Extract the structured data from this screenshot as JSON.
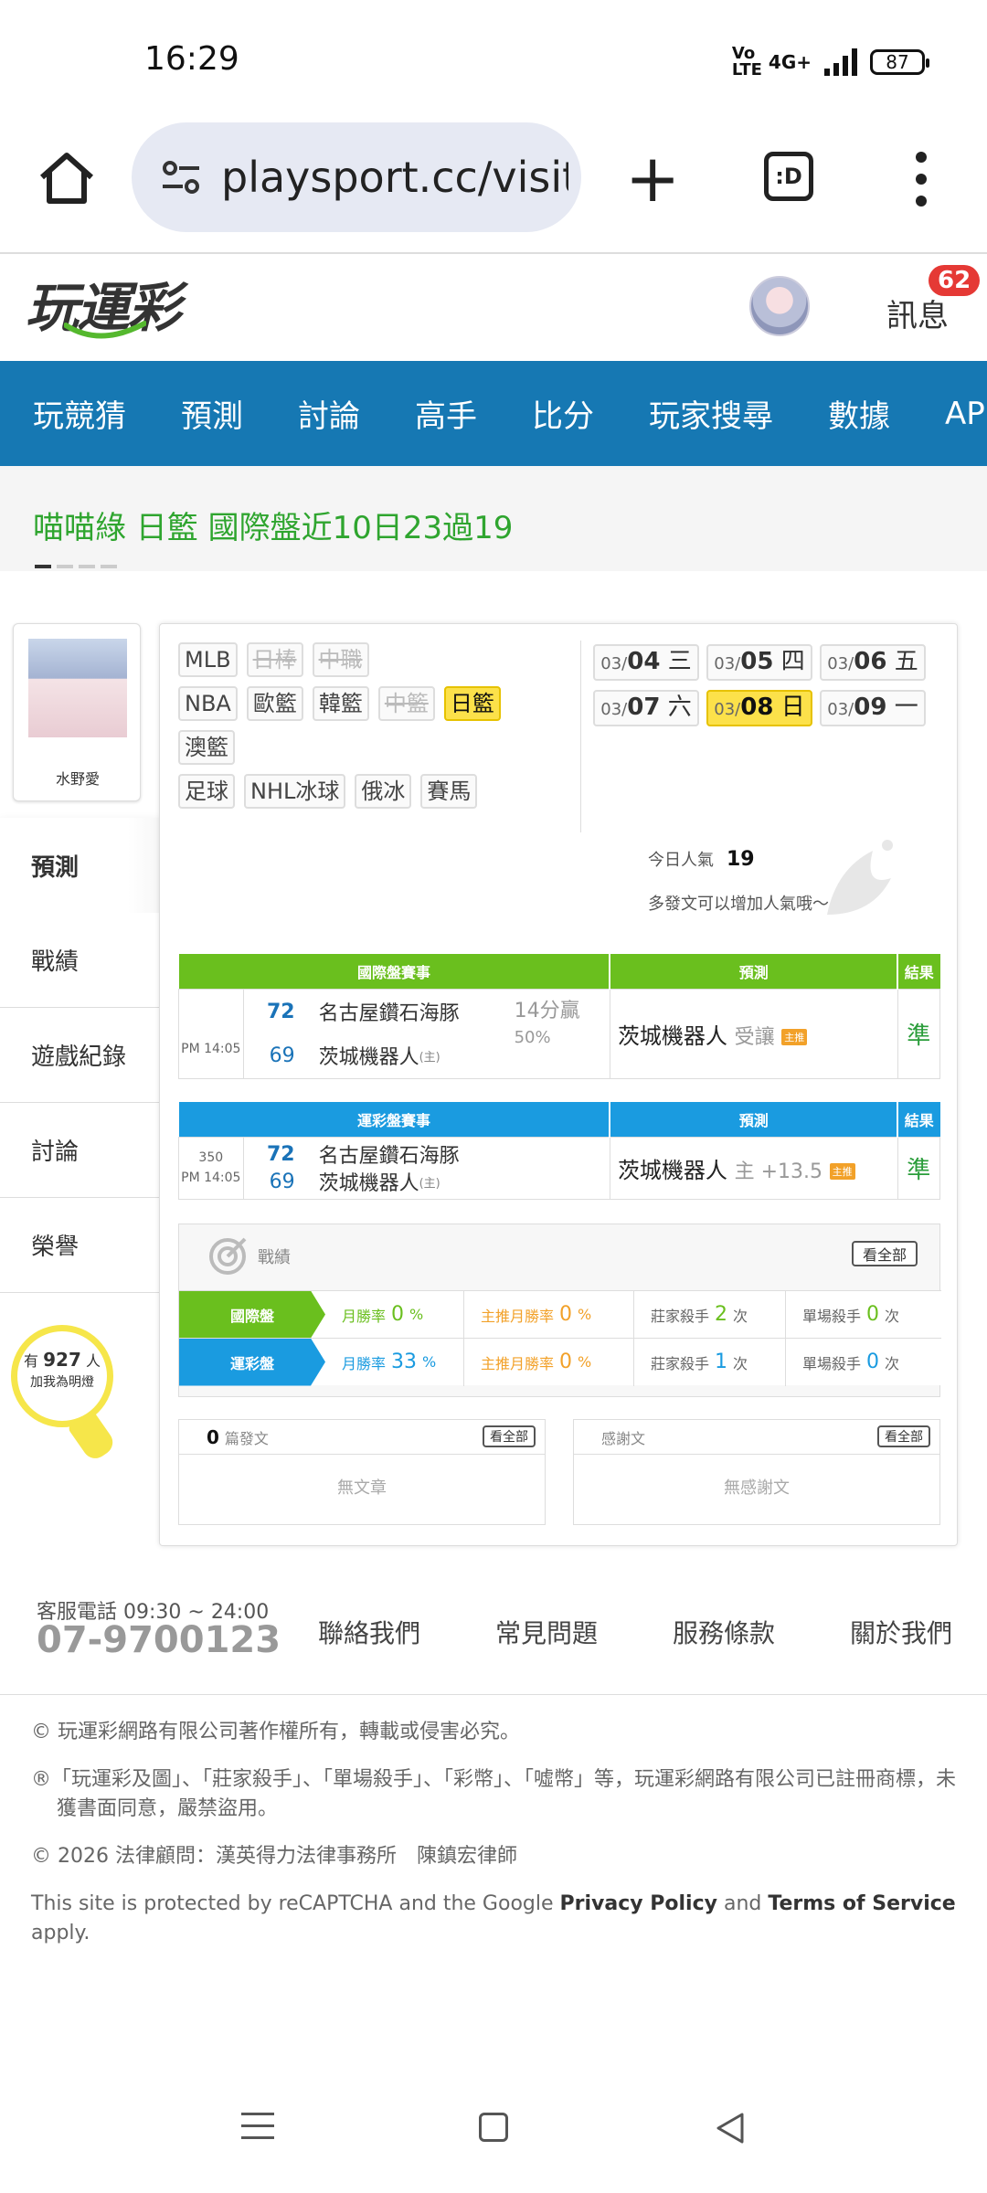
{
  "status": {
    "time": "16:29",
    "volte": "Vo LTE",
    "network": "4G+",
    "battery": "87"
  },
  "browser": {
    "url": "playsport.cc/visit",
    "tabs_label": ":D"
  },
  "header": {
    "logo": "玩運彩",
    "messages_label": "訊息",
    "messages_badge": "62"
  },
  "nav": {
    "items": [
      "玩競猜",
      "預測",
      "討論",
      "高手",
      "比分",
      "玩家搜尋",
      "數據",
      "APP"
    ]
  },
  "marquee": {
    "text": "喵喵綠 日籃 國際盤近10日23過19"
  },
  "profile": {
    "name": "水野愛"
  },
  "side_menu": [
    "預測",
    "戰績",
    "遊戲紀錄",
    "討論",
    "榮譽"
  ],
  "fans": {
    "prefix": "有",
    "count": "927",
    "suffix": "人",
    "subtitle": "加我為明燈"
  },
  "leagues": {
    "row1": [
      {
        "label": "MLB",
        "state": "normal"
      },
      {
        "label": "日棒",
        "state": "disabled"
      },
      {
        "label": "中職",
        "state": "disabled"
      }
    ],
    "row2": [
      {
        "label": "NBA",
        "state": "normal"
      },
      {
        "label": "歐籃",
        "state": "normal"
      },
      {
        "label": "韓籃",
        "state": "normal"
      },
      {
        "label": "中籃",
        "state": "disabled"
      },
      {
        "label": "日籃",
        "state": "selected"
      }
    ],
    "row3": [
      {
        "label": "澳籃",
        "state": "normal"
      }
    ],
    "row4": [
      {
        "label": "足球",
        "state": "normal"
      },
      {
        "label": "NHL冰球",
        "state": "normal"
      },
      {
        "label": "俄冰",
        "state": "normal"
      },
      {
        "label": "賽馬",
        "state": "normal"
      }
    ]
  },
  "dates": [
    {
      "month": "03/",
      "day": "04",
      "weekday": "三",
      "selected": false
    },
    {
      "month": "03/",
      "day": "05",
      "weekday": "四",
      "selected": false
    },
    {
      "month": "03/",
      "day": "06",
      "weekday": "五",
      "selected": false
    },
    {
      "month": "03/",
      "day": "07",
      "weekday": "六",
      "selected": false
    },
    {
      "month": "03/",
      "day": "08",
      "weekday": "日",
      "selected": true
    },
    {
      "month": "03/",
      "day": "09",
      "weekday": "一",
      "selected": false
    }
  ],
  "popularity": {
    "label": "今日人氣",
    "value": "19",
    "hint": "多發文可以增加人氣哦～"
  },
  "intl_table": {
    "headers": [
      "國際盤賽事",
      "預測",
      "結果"
    ],
    "time": "PM 14:05",
    "away_score": "72",
    "away_team": "名古屋鑽石海豚",
    "home_score": "69",
    "home_team": "茨城機器人",
    "home_mark": "(主)",
    "spread_line1": "14分贏",
    "spread_line2": "50%",
    "pick_team": "茨城機器人",
    "pick_detail": "受讓",
    "pick_mark": "主推",
    "result": "準"
  },
  "lottery_table": {
    "headers": [
      "運彩盤賽事",
      "預測",
      "結果"
    ],
    "game_no": "350",
    "time": "PM 14:05",
    "away_score": "72",
    "away_team": "名古屋鑽石海豚",
    "home_score": "69",
    "home_team": "茨城機器人",
    "home_mark": "(主)",
    "pick_team": "茨城機器人",
    "pick_detail": "主 +13.5",
    "pick_mark": "主推",
    "result": "準"
  },
  "record": {
    "title": "戰績",
    "all_label": "看全部",
    "rows": [
      {
        "label": "國際盤",
        "color": "#6abf1e",
        "month_label": "月勝率",
        "month_val": "0",
        "main_label": "主推月勝率",
        "main_val": "0",
        "bank_label": "莊家殺手",
        "bank_val": "2",
        "single_label": "單場殺手",
        "single_val": "0"
      },
      {
        "label": "運彩盤",
        "color": "#1a9be0",
        "month_label": "月勝率",
        "month_val": "33",
        "main_label": "主推月勝率",
        "main_val": "0",
        "bank_label": "莊家殺手",
        "bank_val": "1",
        "single_label": "單場殺手",
        "single_val": "0"
      }
    ],
    "pct": "%",
    "times": "次"
  },
  "posts": {
    "count": "0",
    "label": "篇發文",
    "all_label": "看全部",
    "empty": "無文章"
  },
  "thanks": {
    "label": "感謝文",
    "all_label": "看全部",
    "empty": "無感謝文"
  },
  "footer": {
    "phone_label": "客服電話 09:30 ~ 24:00",
    "phone": "07-9700123",
    "links": [
      "聯絡我們",
      "常見問題",
      "服務條款",
      "關於我們"
    ],
    "copyright": "© 玩運彩網路有限公司著作權所有，轉載或侵害必究。",
    "trademark": "®「玩運彩及圖」、「莊家殺手」、「單場殺手」、「彩幣」、「噓幣」等，玩運彩網路有限公司已註冊商標，未獲書面同意，嚴禁盜用。",
    "legal": "© 2026 法律顧問：漢英得力法律事務所　陳鎮宏律師",
    "recaptcha_pre": "This site is protected by reCAPTCHA and the Google ",
    "privacy": "Privacy Policy",
    "and": " and ",
    "terms": "Terms of Service",
    "apply": " apply."
  },
  "colors": {
    "nav_bg": "#1678b3",
    "intl_green": "#6abf1e",
    "lottery_blue": "#1a9be0",
    "highlight": "#fce14a",
    "badge_red": "#e53935",
    "marquee_green": "#2fa52f"
  },
  "icons": [
    "home-icon",
    "site-settings-icon",
    "new-tab-icon",
    "tab-switcher-icon",
    "more-menu-icon",
    "avatar",
    "target-icon",
    "lightbulb-icon",
    "leaf-watermark-icon"
  ]
}
